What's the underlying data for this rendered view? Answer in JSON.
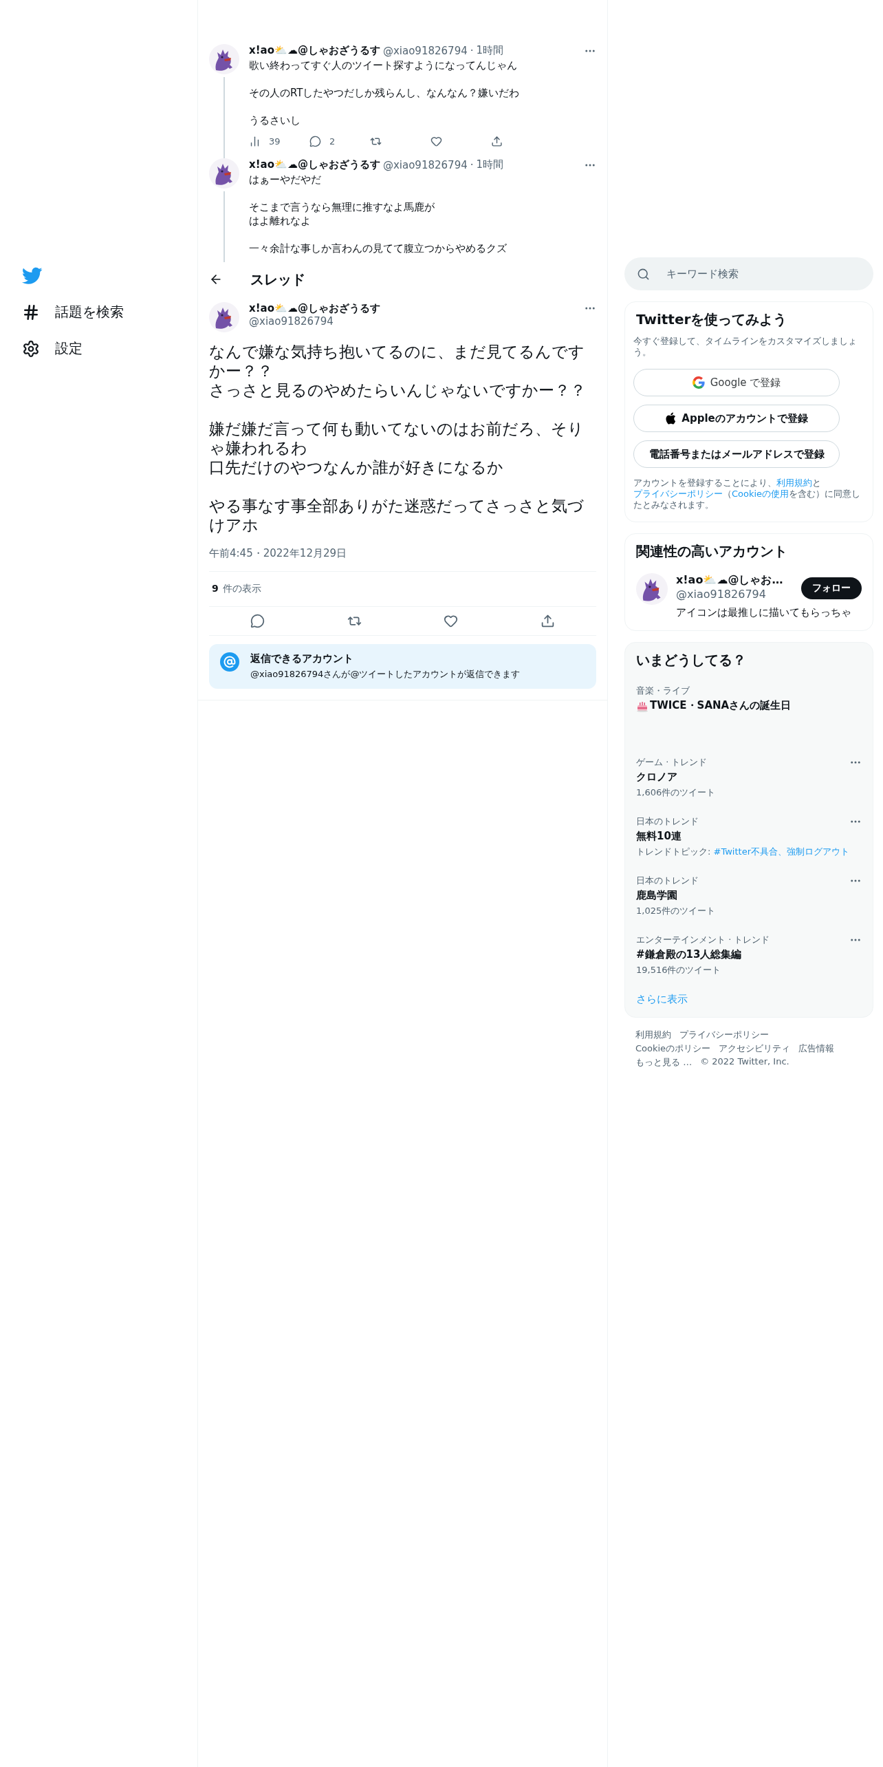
{
  "sidebar": {
    "items": [
      {
        "label": "話題を検索",
        "kind": "explore"
      },
      {
        "label": "設定",
        "kind": "settings"
      }
    ]
  },
  "context_tweets": [
    {
      "author": "x!ao⛅☁@しゃおざうるす",
      "handle": "@xiao91826794",
      "separator": "·",
      "time": "1時間",
      "paragraphs": [
        [
          "歌い終わってすぐ人のツイート探すようになってんじゃん"
        ],
        [
          "その人のRTしたやつだしか残らんし、なんなん？嫌いだわ"
        ],
        [
          "うるさいし"
        ]
      ],
      "stats": {
        "views": "39",
        "replies": "2"
      }
    },
    {
      "author": "x!ao⛅☁@しゃおざうるす",
      "handle": "@xiao91826794",
      "separator": "·",
      "time": "1時間",
      "paragraphs": [
        [
          "はぁーやだやだ"
        ],
        [
          "そこまで言うなら無理に推すなよ馬鹿が",
          "はよ離れなよ"
        ],
        [
          "一々余計な事しか言わんの見てて腹立つからやめるクズ"
        ]
      ]
    }
  ],
  "thread_header": {
    "title": "スレッド"
  },
  "main_tweet": {
    "author": "x!ao⛅☁@しゃおざうるす",
    "handle": "@xiao91826794",
    "paragraphs": [
      [
        "なんで嫌な気持ち抱いてるのに、まだ見てるんですかー？？",
        "さっさと見るのやめたらいんじゃないですかー？？"
      ],
      [
        "嫌だ嫌だ言って何も動いてないのはお前だろ、そりゃ嫌われるわ",
        "口先だけのやつなんか誰が好きになるか"
      ],
      [
        "やる事なす事全部ありがた迷惑だってさっさと気づけアホ"
      ]
    ],
    "timestamp": "午前4:45・2022年12月29日",
    "views_count": "9",
    "views_label": "件の表示"
  },
  "reply_notice": {
    "title": "返信できるアカウント",
    "text": "@xiao91826794さんが@ツイートしたアカウントが返信できます"
  },
  "search": {
    "placeholder": "キーワード検索"
  },
  "signup": {
    "title": "Twitterを使ってみよう",
    "subtitle": "今すぐ登録して、タイムラインをカスタマイズしましょう。",
    "buttons": [
      {
        "label": "Google で登録",
        "kind": "google"
      },
      {
        "label": "Appleのアカウントで登録",
        "kind": "apple"
      },
      {
        "label": "電話番号またはメールアドレスで登録",
        "kind": "plain"
      }
    ],
    "legal": [
      {
        "text": "アカウントを登録することにより、",
        "link": false
      },
      {
        "text": "利用規約",
        "link": true
      },
      {
        "text": "と",
        "link": false
      },
      {
        "text": "プライバシーポリシー",
        "link": true
      },
      {
        "text": "（",
        "link": false
      },
      {
        "text": "Cookieの使用",
        "link": true
      },
      {
        "text": "を含む）に同意したとみなされます。",
        "link": false
      }
    ]
  },
  "related": {
    "title": "関連性の高いアカウント",
    "accounts": [
      {
        "name": "x!ao⛅☁@しゃお…",
        "handle": "@xiao91826794",
        "bio": "アイコンは最推しに描いてもらっちゃ",
        "follow_label": "フォロー"
      }
    ]
  },
  "trends": {
    "title": "いまどうしてる？",
    "items": [
      {
        "kind": "event",
        "category": "音楽・ライブ",
        "name": "TWICE・SANAさんの誕生日"
      },
      {
        "kind": "trend",
        "category": "ゲーム · トレンド",
        "name": "クロノア",
        "meta": "1,606件のツイート"
      },
      {
        "kind": "trend",
        "category": "日本のトレンド",
        "name": "無料10連",
        "meta": "トレンドトピック: ",
        "meta_link": "#Twitter不具合、強制ログアウト"
      },
      {
        "kind": "trend",
        "category": "日本のトレンド",
        "name": "鹿島学園",
        "meta": "1,025件のツイート"
      },
      {
        "kind": "trend",
        "category": "エンターテインメント · トレンド",
        "name": "#鎌倉殿の13人総集編",
        "meta": "19,516件のツイート"
      }
    ],
    "show_more": "さらに表示"
  },
  "footer": {
    "links": [
      "利用規約",
      "プライバシーポリシー",
      "Cookieのポリシー",
      "アクセシビリティ",
      "広告情報",
      "もっと見る …"
    ],
    "copyright": "© 2022 Twitter, Inc."
  }
}
